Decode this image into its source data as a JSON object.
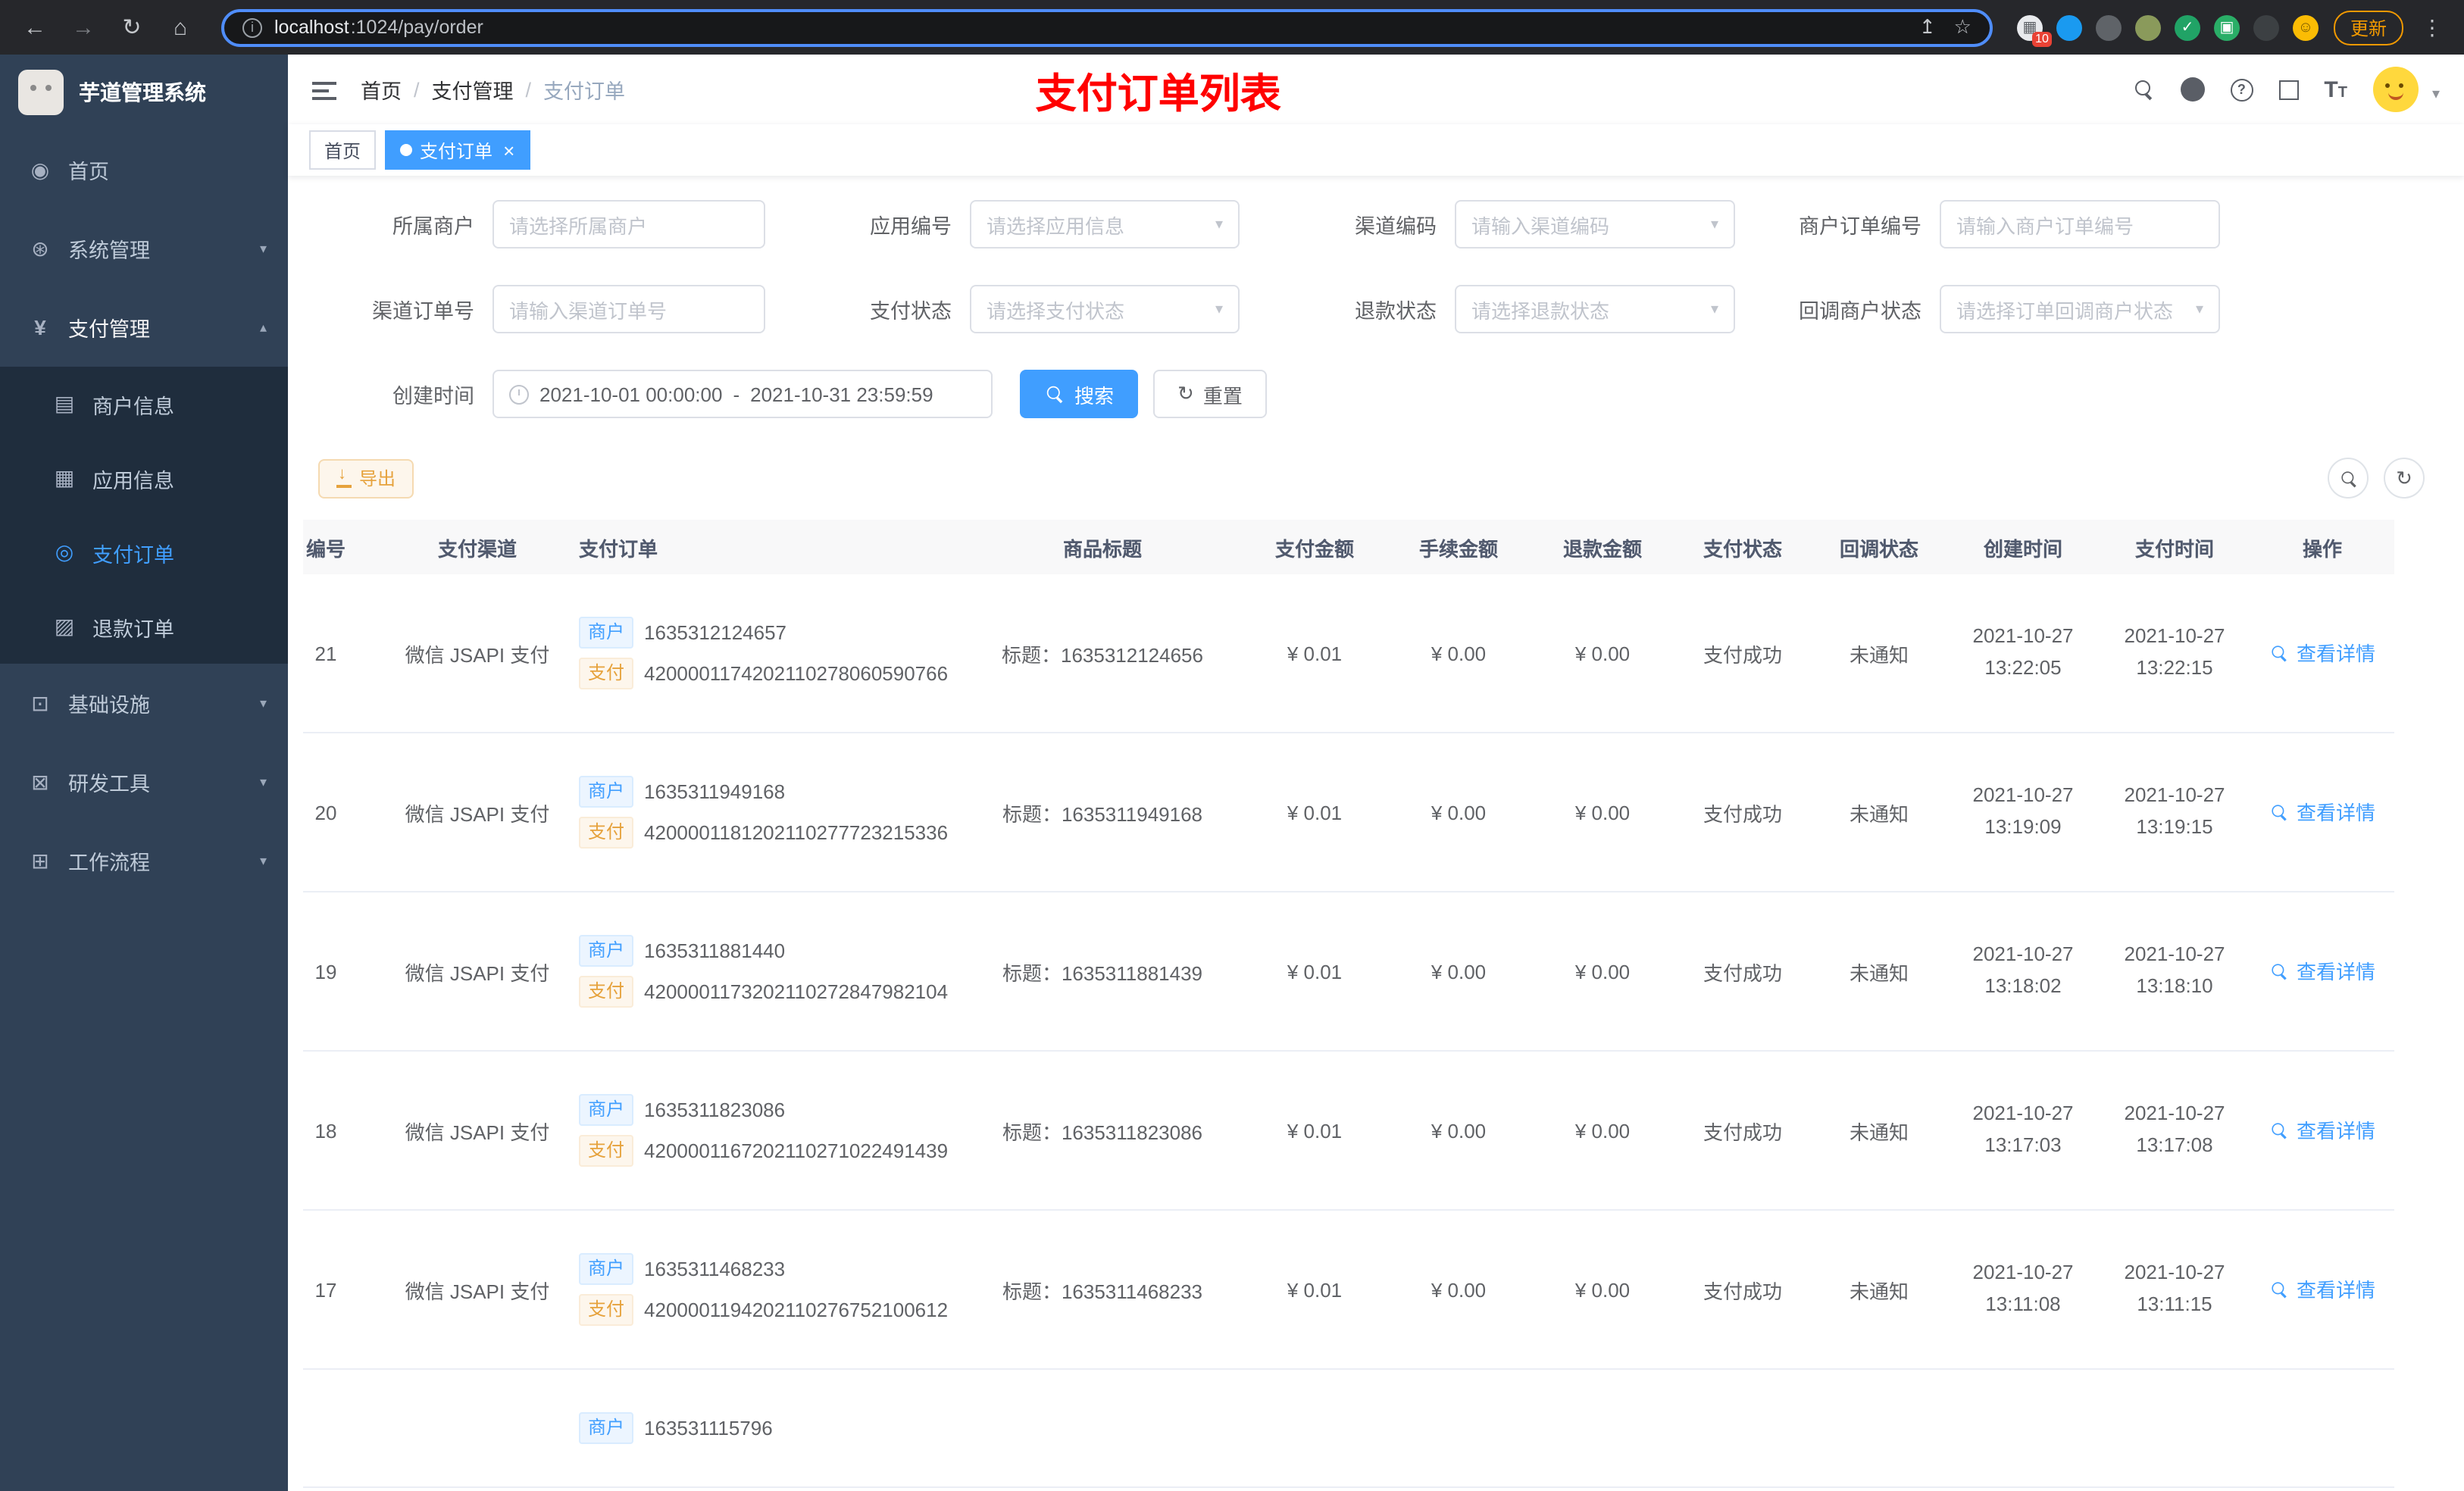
{
  "browser": {
    "url_host": "localhost",
    "url_rest": ":1024/pay/order",
    "update_label": "更新",
    "extensions": [
      {
        "name": "extension-grid",
        "color": "#e8eaed",
        "fg": "#5f6368",
        "glyph": "▦",
        "badge": "10"
      },
      {
        "name": "extension-drop-blue",
        "color": "#1a9af0",
        "fg": "#ffffff",
        "glyph": ""
      },
      {
        "name": "extension-round-dark",
        "color": "#5f6368",
        "fg": "#ffffff",
        "glyph": ""
      },
      {
        "name": "extension-round-olive",
        "color": "#8a9a5b",
        "fg": "#ffffff",
        "glyph": ""
      },
      {
        "name": "extension-check-green",
        "color": "#21a366",
        "fg": "#ffffff",
        "glyph": "✓"
      },
      {
        "name": "extension-chat-green",
        "color": "#2aae67",
        "fg": "#ffffff",
        "glyph": "▣"
      },
      {
        "name": "extension-pin-dark",
        "color": "#3c4043",
        "fg": "#ffffff",
        "glyph": ""
      },
      {
        "name": "extension-smiley",
        "color": "#fbbc04",
        "fg": "#7a5b00",
        "glyph": "☺"
      }
    ]
  },
  "sidebar": {
    "logo_title": "芋道管理系统",
    "items": [
      {
        "label": "首页",
        "icon": "dashboard",
        "type": "top"
      },
      {
        "label": "系统管理",
        "icon": "gear",
        "type": "top",
        "arrow": "down"
      },
      {
        "label": "支付管理",
        "icon": "yen",
        "type": "top",
        "arrow": "up",
        "expanded": true
      },
      {
        "label": "商户信息",
        "icon": "merchant",
        "type": "sub"
      },
      {
        "label": "应用信息",
        "icon": "app",
        "type": "sub"
      },
      {
        "label": "支付订单",
        "icon": "order",
        "type": "sub",
        "active": true
      },
      {
        "label": "退款订单",
        "icon": "refund",
        "type": "sub"
      },
      {
        "label": "基础设施",
        "icon": "infra",
        "type": "top",
        "arrow": "down"
      },
      {
        "label": "研发工具",
        "icon": "tools",
        "type": "top",
        "arrow": "down"
      },
      {
        "label": "工作流程",
        "icon": "workflow",
        "type": "top",
        "arrow": "down"
      }
    ]
  },
  "header": {
    "breadcrumb": [
      "首页",
      "支付管理",
      "支付订单"
    ],
    "page_title": "支付订单列表"
  },
  "tabs": [
    {
      "label": "首页",
      "active": false
    },
    {
      "label": "支付订单",
      "active": true
    }
  ],
  "filters": {
    "rows": [
      [
        {
          "label": "所属商户",
          "placeholder": "请选择所属商户",
          "type": "input"
        },
        {
          "label": "应用编号",
          "placeholder": "请选择应用信息",
          "type": "select"
        },
        {
          "label": "渠道编码",
          "placeholder": "请输入渠道编码",
          "type": "select"
        },
        {
          "label": "商户订单编号",
          "placeholder": "请输入商户订单编号",
          "type": "input"
        }
      ],
      [
        {
          "label": "渠道订单号",
          "placeholder": "请输入渠道订单号",
          "type": "input"
        },
        {
          "label": "支付状态",
          "placeholder": "请选择支付状态",
          "type": "select"
        },
        {
          "label": "退款状态",
          "placeholder": "请选择退款状态",
          "type": "select"
        },
        {
          "label": "回调商户状态",
          "placeholder": "请选择订单回调商户状态",
          "type": "select"
        }
      ]
    ],
    "date": {
      "label": "创建时间",
      "start": "2021-10-01 00:00:00",
      "separator": "-",
      "end": "2021-10-31 23:59:59"
    },
    "search_label": "搜索",
    "reset_label": "重置"
  },
  "toolbar": {
    "export_label": "导出"
  },
  "table": {
    "columns": [
      "编号",
      "支付渠道",
      "支付订单",
      "商品标题",
      "支付金额",
      "手续金额",
      "退款金额",
      "支付状态",
      "回调状态",
      "创建时间",
      "支付时间",
      "操作"
    ],
    "tag_merchant": "商户",
    "tag_pay": "支付",
    "action_label": "查看详情",
    "rows": [
      {
        "id": "21",
        "channel": "微信 JSAPI 支付",
        "merchant_no": "1635312124657",
        "pay_no": "4200001174202110278060590766",
        "title": "标题：1635312124656",
        "amount": "¥ 0.01",
        "fee": "¥ 0.00",
        "refund": "¥ 0.00",
        "status": "支付成功",
        "notify": "未通知",
        "created_date": "2021-10-27",
        "created_time": "13:22:05",
        "paid_date": "2021-10-27",
        "paid_time": "13:22:15"
      },
      {
        "id": "20",
        "channel": "微信 JSAPI 支付",
        "merchant_no": "1635311949168",
        "pay_no": "4200001181202110277723215336",
        "title": "标题：1635311949168",
        "amount": "¥ 0.01",
        "fee": "¥ 0.00",
        "refund": "¥ 0.00",
        "status": "支付成功",
        "notify": "未通知",
        "created_date": "2021-10-27",
        "created_time": "13:19:09",
        "paid_date": "2021-10-27",
        "paid_time": "13:19:15"
      },
      {
        "id": "19",
        "channel": "微信 JSAPI 支付",
        "merchant_no": "1635311881440",
        "pay_no": "4200001173202110272847982104",
        "title": "标题：1635311881439",
        "amount": "¥ 0.01",
        "fee": "¥ 0.00",
        "refund": "¥ 0.00",
        "status": "支付成功",
        "notify": "未通知",
        "created_date": "2021-10-27",
        "created_time": "13:18:02",
        "paid_date": "2021-10-27",
        "paid_time": "13:18:10"
      },
      {
        "id": "18",
        "channel": "微信 JSAPI 支付",
        "merchant_no": "1635311823086",
        "pay_no": "4200001167202110271022491439",
        "title": "标题：1635311823086",
        "amount": "¥ 0.01",
        "fee": "¥ 0.00",
        "refund": "¥ 0.00",
        "status": "支付成功",
        "notify": "未通知",
        "created_date": "2021-10-27",
        "created_time": "13:17:03",
        "paid_date": "2021-10-27",
        "paid_time": "13:17:08"
      },
      {
        "id": "17",
        "channel": "微信 JSAPI 支付",
        "merchant_no": "1635311468233",
        "pay_no": "4200001194202110276752100612",
        "title": "标题：1635311468233",
        "amount": "¥ 0.01",
        "fee": "¥ 0.00",
        "refund": "¥ 0.00",
        "status": "支付成功",
        "notify": "未通知",
        "created_date": "2021-10-27",
        "created_time": "13:11:08",
        "paid_date": "2021-10-27",
        "paid_time": "13:11:15"
      },
      {
        "id": "",
        "channel": "",
        "merchant_no": "163531115796",
        "pay_no": "",
        "title": "",
        "amount": "",
        "fee": "",
        "refund": "",
        "status": "",
        "notify": "",
        "created_date": "",
        "created_time": "",
        "paid_date": "",
        "paid_time": ""
      }
    ]
  }
}
